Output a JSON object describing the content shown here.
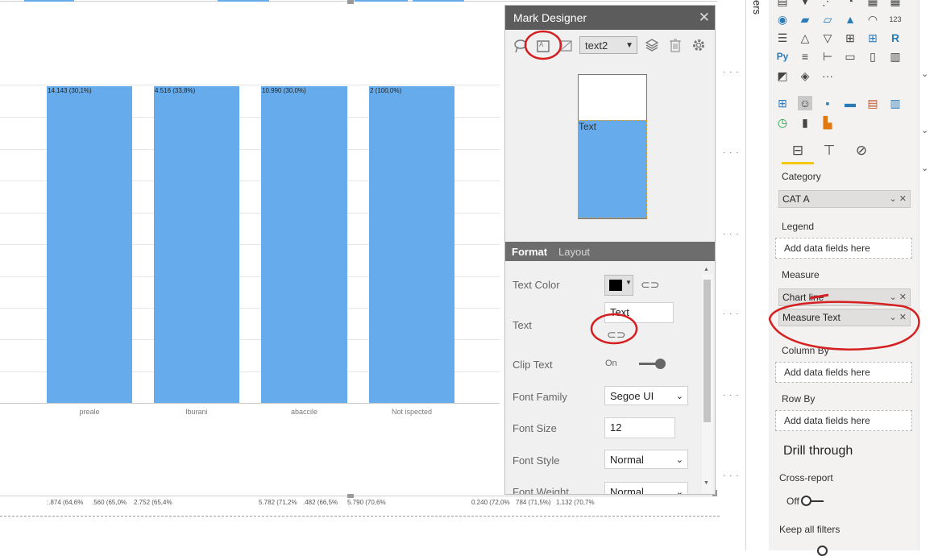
{
  "chart": {
    "bar_labels": [
      "14.143 (30,1%)",
      "4.516 (33,8%)",
      "10.990 (30,0%)",
      "2 (100,0%)"
    ],
    "x_labels": [
      "preale",
      "lburani",
      "abaccile",
      "Not ispected"
    ],
    "bottom_labels": [
      ":.874 (64,6%",
      ".560 (65,0%",
      "2.752 (65,4%",
      "5.782 (71,2%",
      ".482 (66,5%",
      "5.790 (70,6%",
      "0.240 (72,0%",
      "784 (71,5%)",
      "1.132 (70,7%"
    ],
    "bar_color": "#66acec"
  },
  "mark_designer": {
    "title": "Mark Designer",
    "close": "✕",
    "mark_select": "text2",
    "preview_text": "Text",
    "tabs": {
      "format": "Format",
      "layout": "Layout"
    },
    "rows": {
      "text_color": "Text Color",
      "text": "Text",
      "text_value": "Text",
      "clip_text": "Clip Text",
      "clip_value": "On",
      "font_family": "Font Family",
      "font_family_value": "Segoe UI",
      "font_size": "Font Size",
      "font_size_value": "12",
      "font_style": "Font Style",
      "font_style_value": "Normal",
      "font_weight": "Font Weight",
      "font_weight_value": "Normal"
    },
    "icons": [
      "lasso-icon",
      "text-mark-icon",
      "image-mark-icon",
      "layers-icon",
      "trash-icon",
      "gear-icon"
    ]
  },
  "filters_pane": {
    "label": "ers"
  },
  "viz_pane": {
    "wells": {
      "category": "Category",
      "category_field": "CAT A",
      "legend": "Legend",
      "legend_placeholder": "Add data fields here",
      "measure": "Measure",
      "measure_field_1": "Chart line",
      "measure_field_2": "Measure Text",
      "column_by": "Column By",
      "column_placeholder": "Add data fields here",
      "row_by": "Row By",
      "row_placeholder": "Add data fields here"
    },
    "drill_through": "Drill through",
    "cross_report": "Cross-report",
    "cross_report_value": "Off",
    "keep_all_filters": "Keep all filters"
  },
  "annotation_color": "#d42020"
}
